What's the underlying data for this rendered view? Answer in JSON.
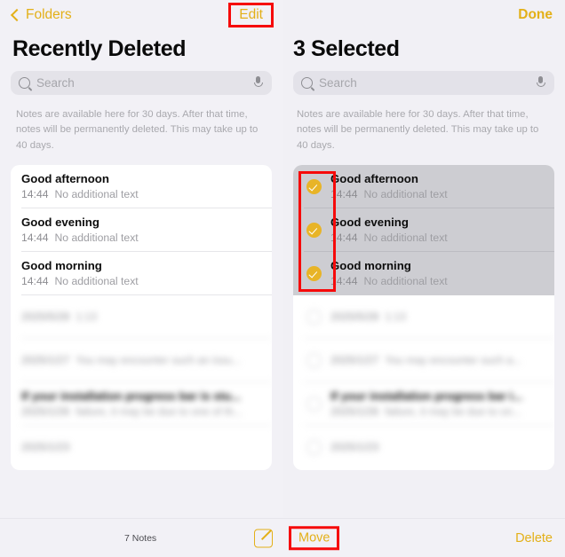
{
  "left": {
    "nav": {
      "back_label": "Folders",
      "back_icon": "chevron-left-icon",
      "action_label": "Edit"
    },
    "title": "Recently Deleted",
    "search": {
      "placeholder": "Search",
      "search_icon": "search-icon",
      "mic_icon": "microphone-icon"
    },
    "info": "Notes are available here for 30 days. After that time, notes will be permanently deleted. This may take up to 40 days.",
    "rows": [
      {
        "title": "Good afternoon",
        "time": "14:44",
        "preview": "No additional text",
        "blurred": false
      },
      {
        "title": "Good evening",
        "time": "14:44",
        "preview": "No additional text",
        "blurred": false
      },
      {
        "title": "Good morning",
        "time": "14:44",
        "preview": "No additional text",
        "blurred": false
      },
      {
        "title": "",
        "time": "2025/5/28",
        "preview": "1:13",
        "blurred": true
      },
      {
        "title": "",
        "time": "2025/1/27",
        "preview": "You may encounter such an issu...",
        "blurred": true
      },
      {
        "title": "If your installation progress bar is stu...",
        "time": "2025/1/26",
        "preview": "failure, it may be due to one of th...",
        "blurred": true
      },
      {
        "title": "",
        "time": "2025/1/23",
        "preview": "",
        "blurred": true
      }
    ]
  },
  "right": {
    "nav": {
      "action_label": "Done"
    },
    "title": "3 Selected",
    "search": {
      "placeholder": "Search",
      "search_icon": "search-icon",
      "mic_icon": "microphone-icon"
    },
    "info": "Notes are available here for 30 days. After that time, notes will be permanently deleted. This may take up to 40 days.",
    "rows": [
      {
        "title": "Good afternoon",
        "time": "14:44",
        "preview": "No additional text",
        "checked": true,
        "blurred": false
      },
      {
        "title": "Good evening",
        "time": "14:44",
        "preview": "No additional text",
        "checked": true,
        "blurred": false
      },
      {
        "title": "Good morning",
        "time": "14:44",
        "preview": "No additional text",
        "checked": true,
        "blurred": false
      },
      {
        "title": "",
        "time": "2025/5/28",
        "preview": "1:13",
        "checked": false,
        "blurred": true
      },
      {
        "title": "",
        "time": "2025/1/27",
        "preview": "You may encounter such a...",
        "checked": false,
        "blurred": true
      },
      {
        "title": "If your installation progress bar i...",
        "time": "2025/1/26",
        "preview": "failure, it may be due to on...",
        "checked": false,
        "blurred": true
      },
      {
        "title": "",
        "time": "2025/1/23",
        "preview": "",
        "checked": false,
        "blurred": true
      }
    ]
  },
  "bottom_bar": {
    "notes_count": "7 Notes",
    "compose_icon": "compose-note-icon",
    "move_label": "Move",
    "delete_label": "Delete"
  },
  "colors": {
    "accent": "#e3b018",
    "checkbox_on": "#e8b427",
    "highlight_box": "#f60a0a",
    "page_background": "#f2f1f6",
    "card_background": "#ffffff",
    "selected_row": "#cdcdd2"
  },
  "annotations": [
    {
      "name": "edit-button-highlight",
      "target": "Edit"
    },
    {
      "name": "checkbox-column-highlight",
      "target": "selected checkmarks"
    },
    {
      "name": "move-button-highlight",
      "target": "Move"
    }
  ]
}
